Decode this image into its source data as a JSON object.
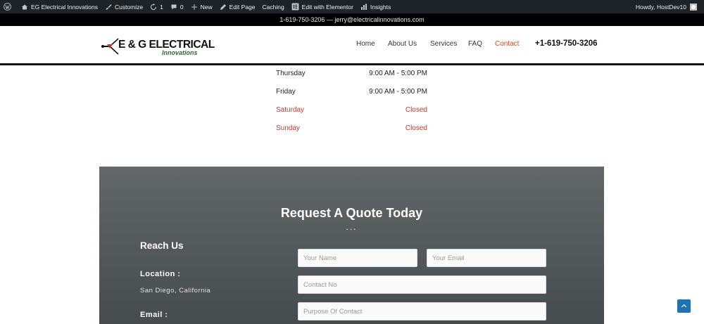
{
  "adminbar": {
    "site_name": "EG Electrical Innovations",
    "customize": "Customize",
    "updates_count": "1",
    "comments_count": "0",
    "new": "New",
    "edit_page": "Edit Page",
    "caching": "Caching",
    "edit_elementor": "Edit with Elementor",
    "insights": "Insights",
    "howdy": "Howdy, HostDev10"
  },
  "topbar": {
    "contact": "1-619-750-3206 — jerry@electricalinnovations.com"
  },
  "header": {
    "logo_main": "E & G ELECTRICAL",
    "logo_sub": "Innovations",
    "nav": [
      "Home",
      "About Us",
      "Services",
      "FAQ",
      "Contact"
    ],
    "active_nav": "Contact",
    "phone": "+1-619-750-3206"
  },
  "hours": [
    {
      "day": "Thursday",
      "time": "9:00 AM - 5:00 PM",
      "closed": false
    },
    {
      "day": "Friday",
      "time": "9:00 AM - 5:00 PM",
      "closed": false
    },
    {
      "day": "Saturday",
      "time": "Closed",
      "closed": true
    },
    {
      "day": "Sunday",
      "time": "Closed",
      "closed": true
    }
  ],
  "quote": {
    "title": "Request A Quote Today",
    "dots": "...",
    "reach_us": "Reach Us",
    "location_label": "Location :",
    "location_value": "San Diego, California",
    "email_label": "Email :",
    "form": {
      "name_placeholder": "Your Name",
      "email_placeholder": "Your Email",
      "contact_placeholder": "Contact No",
      "purpose_placeholder": "Purpose Of Contact"
    }
  },
  "colors": {
    "accent": "#d9472b",
    "closed": "#c0392b",
    "adminbar": "#1d2327",
    "scrolltop": "#2271b1"
  }
}
